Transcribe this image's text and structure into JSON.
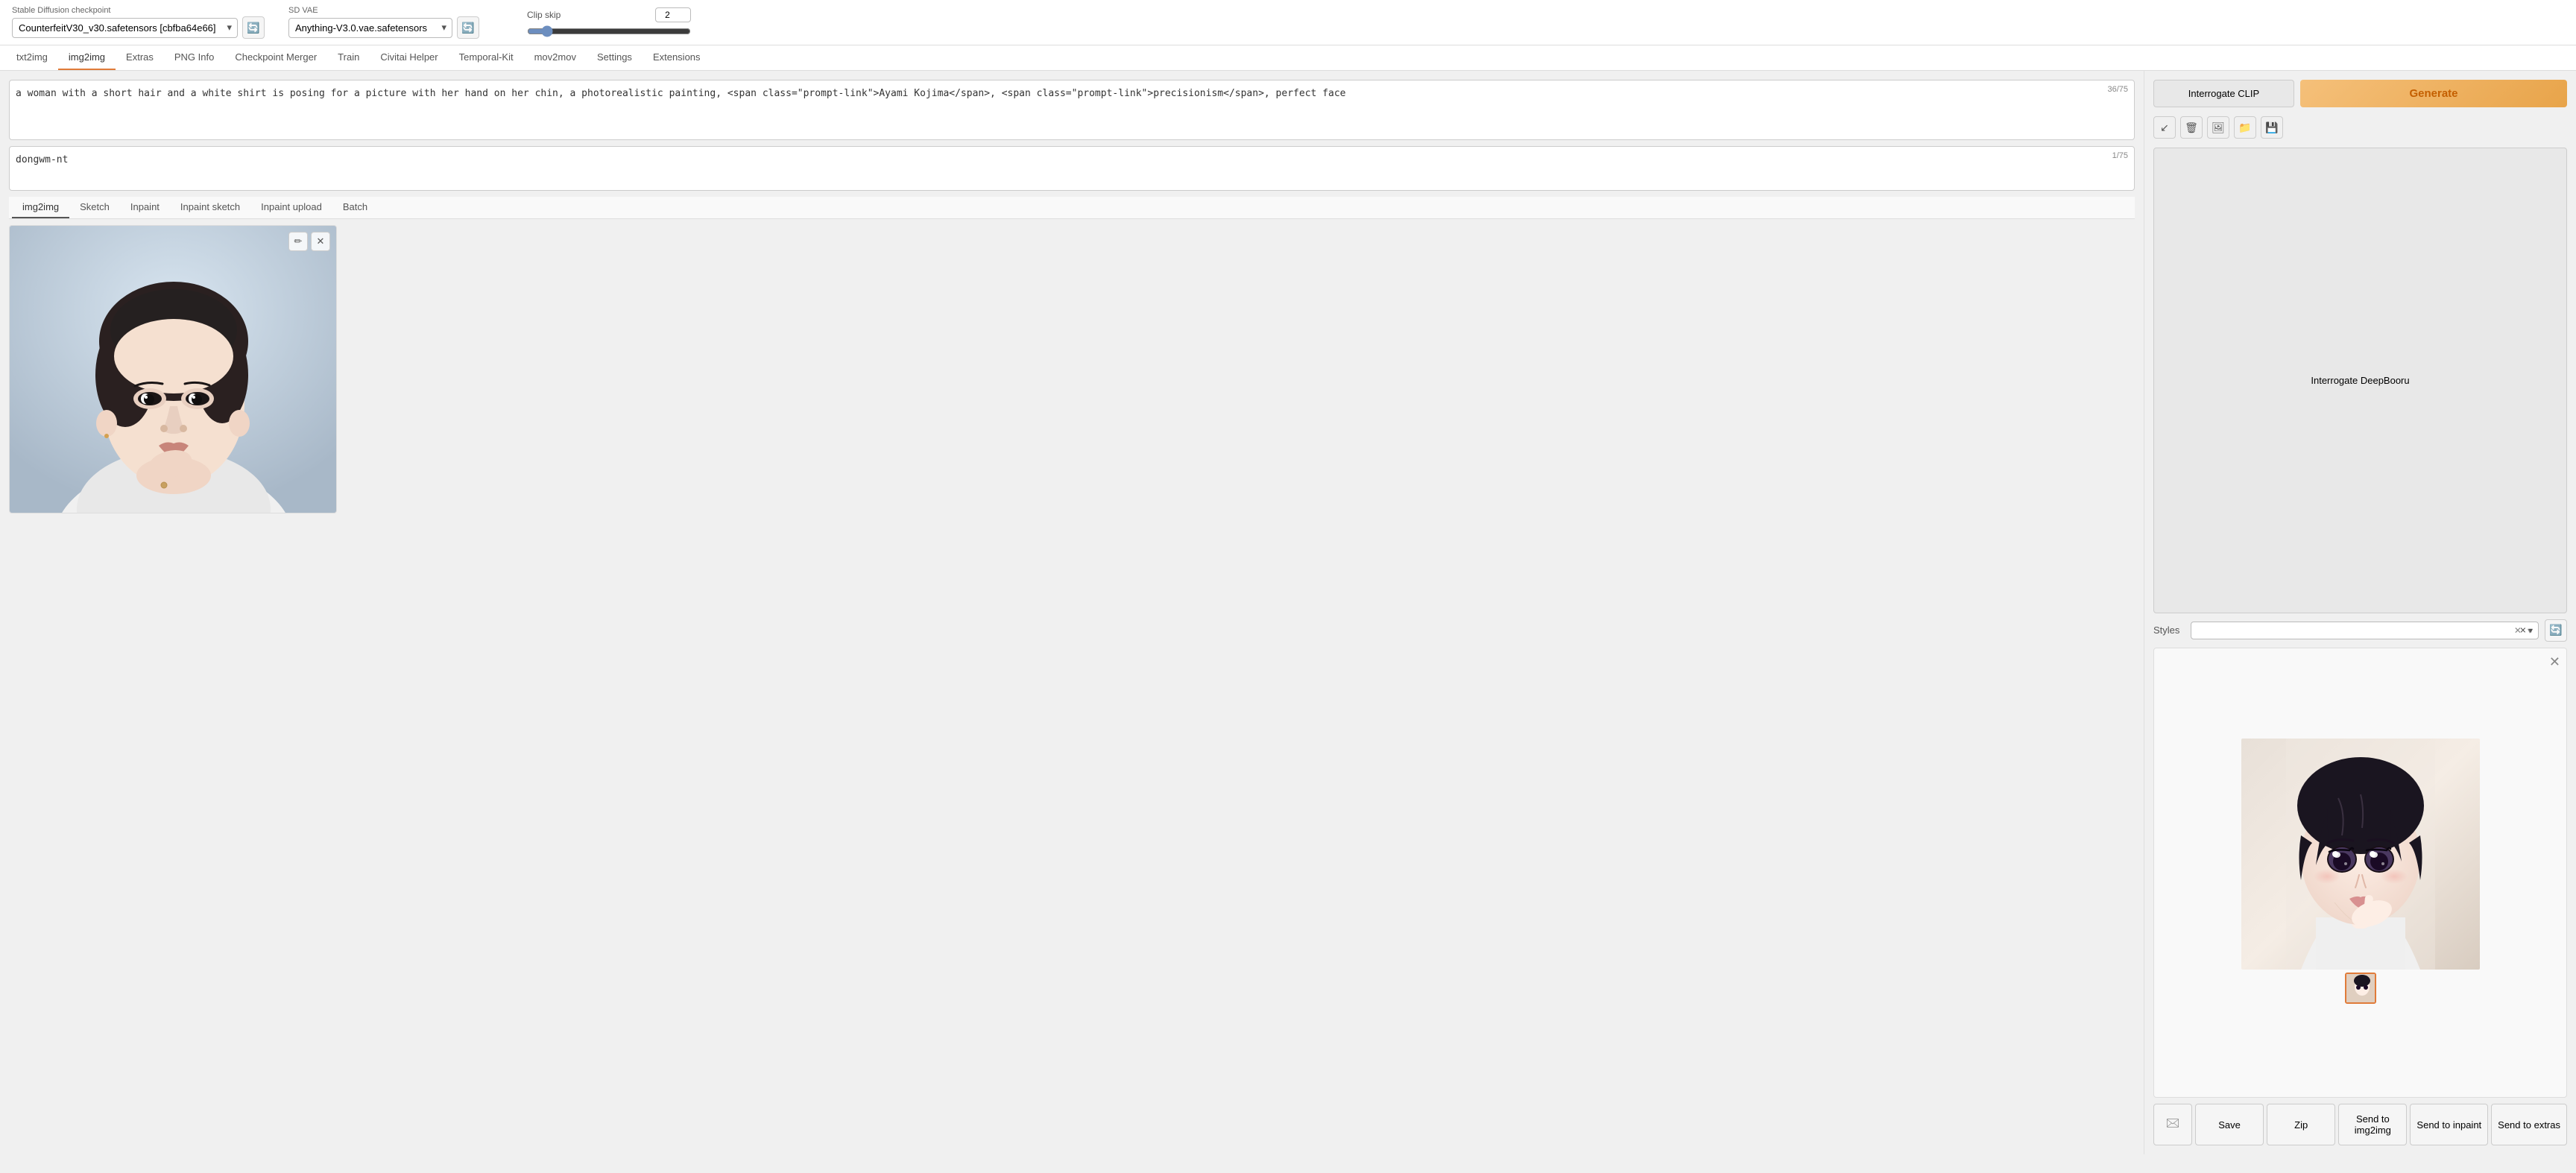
{
  "header": {
    "checkpoint_label": "Stable Diffusion checkpoint",
    "checkpoint_value": "CounterfeitV30_v30.safetensors [cbfba64e66]",
    "vae_label": "SD VAE",
    "vae_value": "Anything-V3.0.vae.safetensors",
    "clip_skip_label": "Clip skip",
    "clip_skip_value": "2",
    "clip_skip_min": 1,
    "clip_skip_max": 12
  },
  "nav": {
    "tabs": [
      {
        "label": "txt2img",
        "active": false
      },
      {
        "label": "img2img",
        "active": true
      },
      {
        "label": "Extras",
        "active": false
      },
      {
        "label": "PNG Info",
        "active": false
      },
      {
        "label": "Checkpoint Merger",
        "active": false
      },
      {
        "label": "Train",
        "active": false
      },
      {
        "label": "Civitai Helper",
        "active": false
      },
      {
        "label": "Temporal-Kit",
        "active": false
      },
      {
        "label": "mov2mov",
        "active": false
      },
      {
        "label": "Settings",
        "active": false
      },
      {
        "label": "Extensions",
        "active": false
      }
    ]
  },
  "prompt": {
    "positive_text": "a woman with a short hair and a white shirt is posing for a picture with her hand on her chin, a photorealistic painting, Ayami Kojima, precisionism, perfect face",
    "positive_count": "36/75",
    "negative_text": "dongwm-nt",
    "negative_count": "1/75"
  },
  "subtabs": {
    "tabs": [
      {
        "label": "img2img",
        "active": true
      },
      {
        "label": "Sketch",
        "active": false
      },
      {
        "label": "Inpaint",
        "active": false
      },
      {
        "label": "Inpaint sketch",
        "active": false
      },
      {
        "label": "Inpaint upload",
        "active": false
      },
      {
        "label": "Batch",
        "active": false
      }
    ]
  },
  "right_panel": {
    "interrogate_clip_label": "Interrogate CLIP",
    "generate_label": "Generate",
    "interrogate_deepbooru_label": "Interrogate DeepBooru",
    "styles_label": "Styles",
    "styles_placeholder": ""
  },
  "toolbar": {
    "icons": [
      {
        "name": "arrow-icon",
        "symbol": "↙"
      },
      {
        "name": "trash-icon",
        "symbol": "🗑"
      },
      {
        "name": "image-icon",
        "symbol": "🖼"
      },
      {
        "name": "folder-icon",
        "symbol": "📁"
      },
      {
        "name": "zip-icon",
        "symbol": "💾"
      }
    ]
  },
  "action_buttons": {
    "open_folder": "🖂",
    "save": "Save",
    "zip": "Zip",
    "send_to_img2img": "Send to\nimg2img",
    "send_to_inpaint": "Send to inpaint",
    "send_to_extras": "Send to extras"
  },
  "colors": {
    "active_tab_border": "#e07b39",
    "generate_text": "#c45f00",
    "generate_bg_start": "#f5c07a",
    "generate_bg_end": "#e8a44a"
  }
}
